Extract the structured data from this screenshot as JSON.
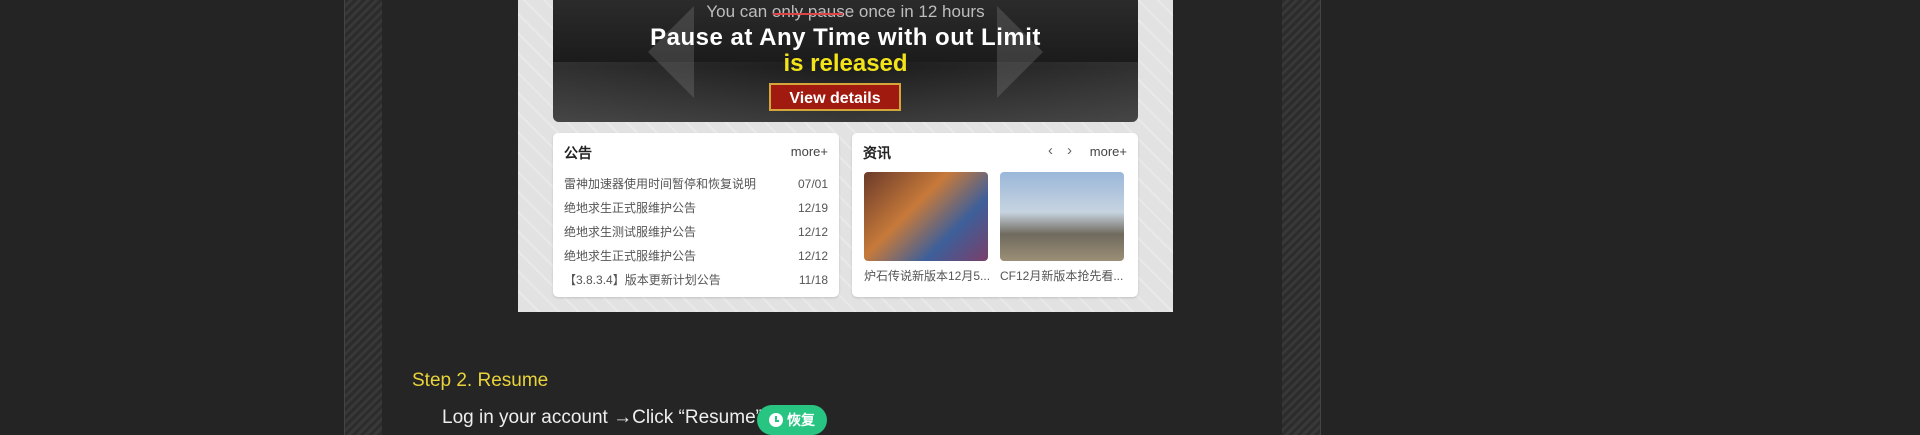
{
  "banner": {
    "subtitle": "You can only pause once in 12 hours",
    "headline": "Pause at Any Time with out Limit",
    "released": "is released",
    "button": "View details"
  },
  "notice": {
    "title": "公告",
    "more": "more+",
    "items": [
      {
        "text": "雷神加速器使用时间暂停和恢复说明",
        "date": "07/01"
      },
      {
        "text": "绝地求生正式服维护公告",
        "date": "12/19"
      },
      {
        "text": "绝地求生测试服维护公告",
        "date": "12/12"
      },
      {
        "text": "绝地求生正式服维护公告",
        "date": "12/12"
      },
      {
        "text": "【3.8.3.4】版本更新计划公告",
        "date": "11/18"
      }
    ]
  },
  "news": {
    "title": "资讯",
    "more": "more+",
    "prev": "‹",
    "next": "›",
    "items": [
      {
        "caption": "炉石传说新版本12月5..."
      },
      {
        "caption": "CF12月新版本抢先看..."
      }
    ]
  },
  "step": {
    "heading": "Step 2. Resume",
    "instruction": "Log in your account →Click “Resume”",
    "resume_label": "恢复"
  },
  "colors": {
    "accent_yellow": "#e9d33a",
    "resume_green": "#27c482",
    "banner_button": "#a11a10"
  }
}
